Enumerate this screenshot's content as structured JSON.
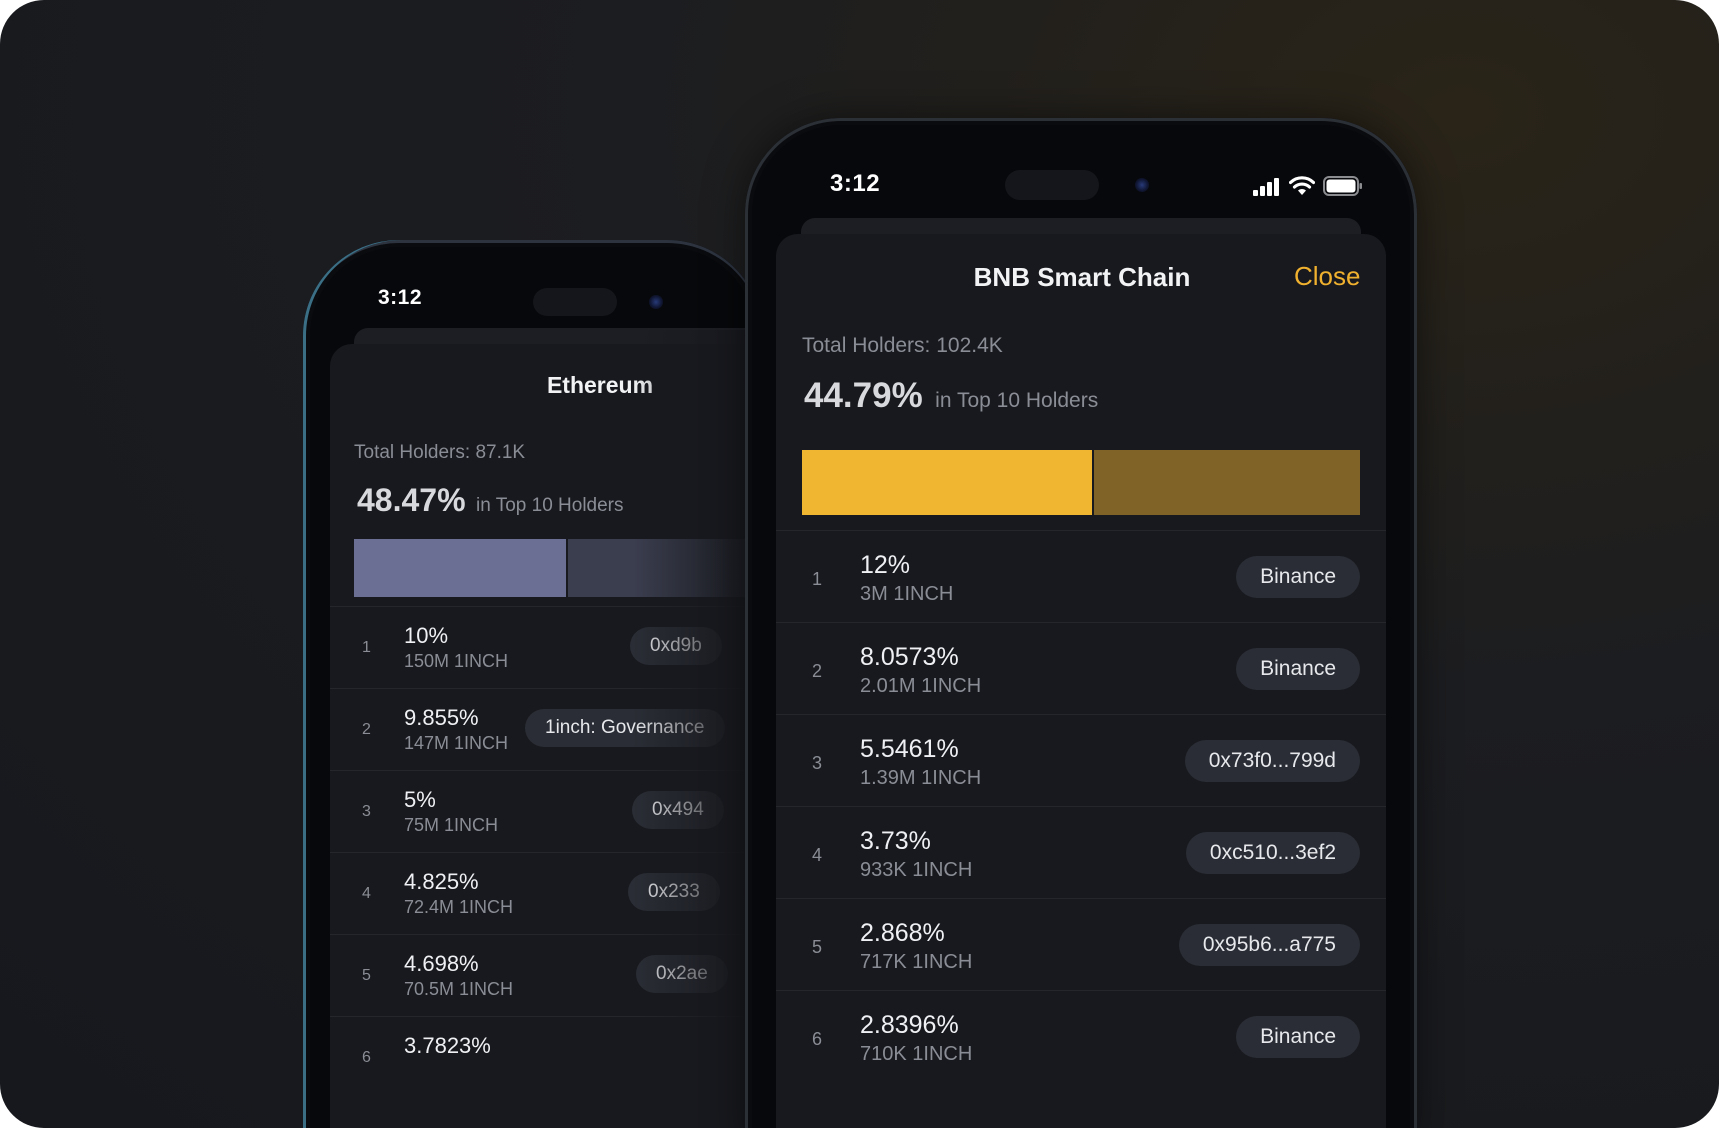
{
  "colors": {
    "accent": "#f0b12f",
    "bnb_bar_top": "#f0b531",
    "bnb_bar_rest": "#806427",
    "eth_bar_top": "#6b6f93",
    "eth_bar_rest": "#3b3e4f"
  },
  "back_phone": {
    "status_time": "3:12",
    "title": "Ethereum",
    "total_holders": "Total Holders: 87.1K",
    "top_pct": "48.47%",
    "top_note": "in Top 10 Holders",
    "top_fraction": 0.4847,
    "holders": [
      {
        "rank": "1",
        "pct": "10%",
        "amount": "150M 1INCH",
        "tag": "0xd9b"
      },
      {
        "rank": "2",
        "pct": "9.855%",
        "amount": "147M 1INCH",
        "tag": "1inch: Governance"
      },
      {
        "rank": "3",
        "pct": "5%",
        "amount": "75M 1INCH",
        "tag": "0x494"
      },
      {
        "rank": "4",
        "pct": "4.825%",
        "amount": "72.4M 1INCH",
        "tag": "0x233"
      },
      {
        "rank": "5",
        "pct": "4.698%",
        "amount": "70.5M 1INCH",
        "tag": "0x2ae"
      },
      {
        "rank": "6",
        "pct": "3.7823%",
        "amount": "",
        "tag": ""
      }
    ]
  },
  "front_phone": {
    "status_time": "3:12",
    "status_icons": [
      "signal-icon",
      "wifi-icon",
      "battery-icon"
    ],
    "title": "BNB Smart Chain",
    "close_label": "Close",
    "total_holders": "Total Holders: 102.4K",
    "top_pct": "44.79%",
    "top_note": "in Top 10 Holders",
    "top_fraction": 0.4479,
    "holders": [
      {
        "rank": "1",
        "pct": "12%",
        "amount": "3M 1INCH",
        "tag": "Binance"
      },
      {
        "rank": "2",
        "pct": "8.0573%",
        "amount": "2.01M 1INCH",
        "tag": "Binance"
      },
      {
        "rank": "3",
        "pct": "5.5461%",
        "amount": "1.39M 1INCH",
        "tag": "0x73f0...799d"
      },
      {
        "rank": "4",
        "pct": "3.73%",
        "amount": "933K 1INCH",
        "tag": "0xc510...3ef2"
      },
      {
        "rank": "5",
        "pct": "2.868%",
        "amount": "717K 1INCH",
        "tag": "0x95b6...a775"
      },
      {
        "rank": "6",
        "pct": "2.8396%",
        "amount": "710K 1INCH",
        "tag": "Binance"
      }
    ]
  }
}
